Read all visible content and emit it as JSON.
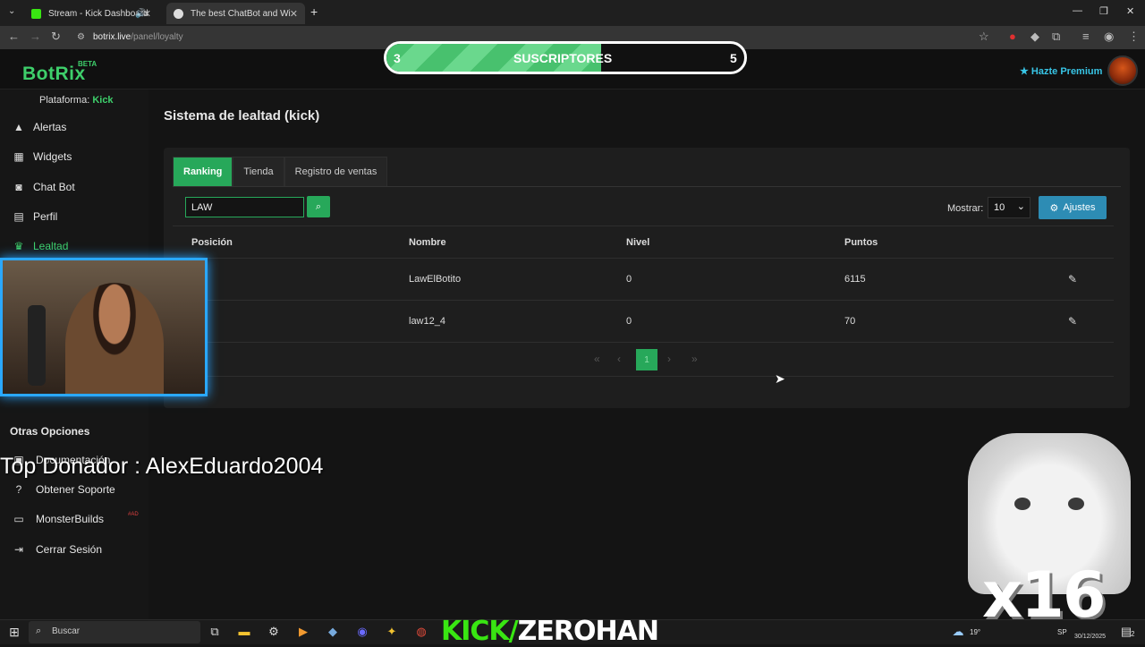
{
  "browser": {
    "tabs": [
      {
        "title": "Stream - Kick Dashboard",
        "active": false
      },
      {
        "title": "The best ChatBot and Widgets",
        "active": true
      }
    ],
    "url_host": "botrix.live",
    "url_path": "/panel/loyalty"
  },
  "header": {
    "logo": "BotRix",
    "logo_badge": "BETA",
    "premium_label": "Hazte Premium"
  },
  "sub_goal": {
    "current": "3",
    "label": "SUSCRIPTORES",
    "target": "5",
    "progress": 0.6
  },
  "sidebar": {
    "platform_label": "Plataforma:",
    "platform_value": "Kick",
    "items": [
      {
        "label": "Alertas",
        "icon": "warning-icon"
      },
      {
        "label": "Widgets",
        "icon": "grid-icon"
      },
      {
        "label": "Chat Bot",
        "icon": "robot-icon"
      },
      {
        "label": "Perfil",
        "icon": "id-card-icon"
      },
      {
        "label": "Lealtad",
        "icon": "trophy-icon",
        "active": true
      }
    ],
    "other_heading": "Otras Opciones",
    "other_items": [
      {
        "label": "Documentación",
        "icon": "book-icon"
      },
      {
        "label": "Obtener Soporte",
        "icon": "question-icon"
      },
      {
        "label": "MonsterBuilds",
        "icon": "laptop-icon",
        "badge": "#AD"
      },
      {
        "label": "Cerrar Sesión",
        "icon": "logout-icon"
      }
    ]
  },
  "main": {
    "title": "Sistema de lealtad (kick)",
    "tabs": [
      "Ranking",
      "Tienda",
      "Registro de ventas"
    ],
    "search_value": "LAW",
    "show_label": "Mostrar:",
    "show_value": "10",
    "settings_label": "Ajustes",
    "columns": [
      "Posición",
      "Nombre",
      "Nivel",
      "Puntos"
    ],
    "rows": [
      {
        "position": "",
        "name": "LawElBotito",
        "level": "0",
        "points": "6115"
      },
      {
        "position": "",
        "name": "law12_4",
        "level": "0",
        "points": "70"
      }
    ],
    "current_page": "1"
  },
  "overlays": {
    "top_donor": "Top Donador : AlexEduardo2004",
    "kick_prefix": "KICK/",
    "kick_channel": "ZEROHAN",
    "multiplier": "x16"
  },
  "taskbar": {
    "search_placeholder": "Buscar",
    "weather": "19°",
    "date": "30/12/2025",
    "lang": "SP",
    "notifications": "2"
  },
  "colors": {
    "accent_green": "#27a85a",
    "logo_green": "#3ecf6b",
    "info_blue": "#2d8cb4",
    "premium_cyan": "#38c5e6"
  }
}
